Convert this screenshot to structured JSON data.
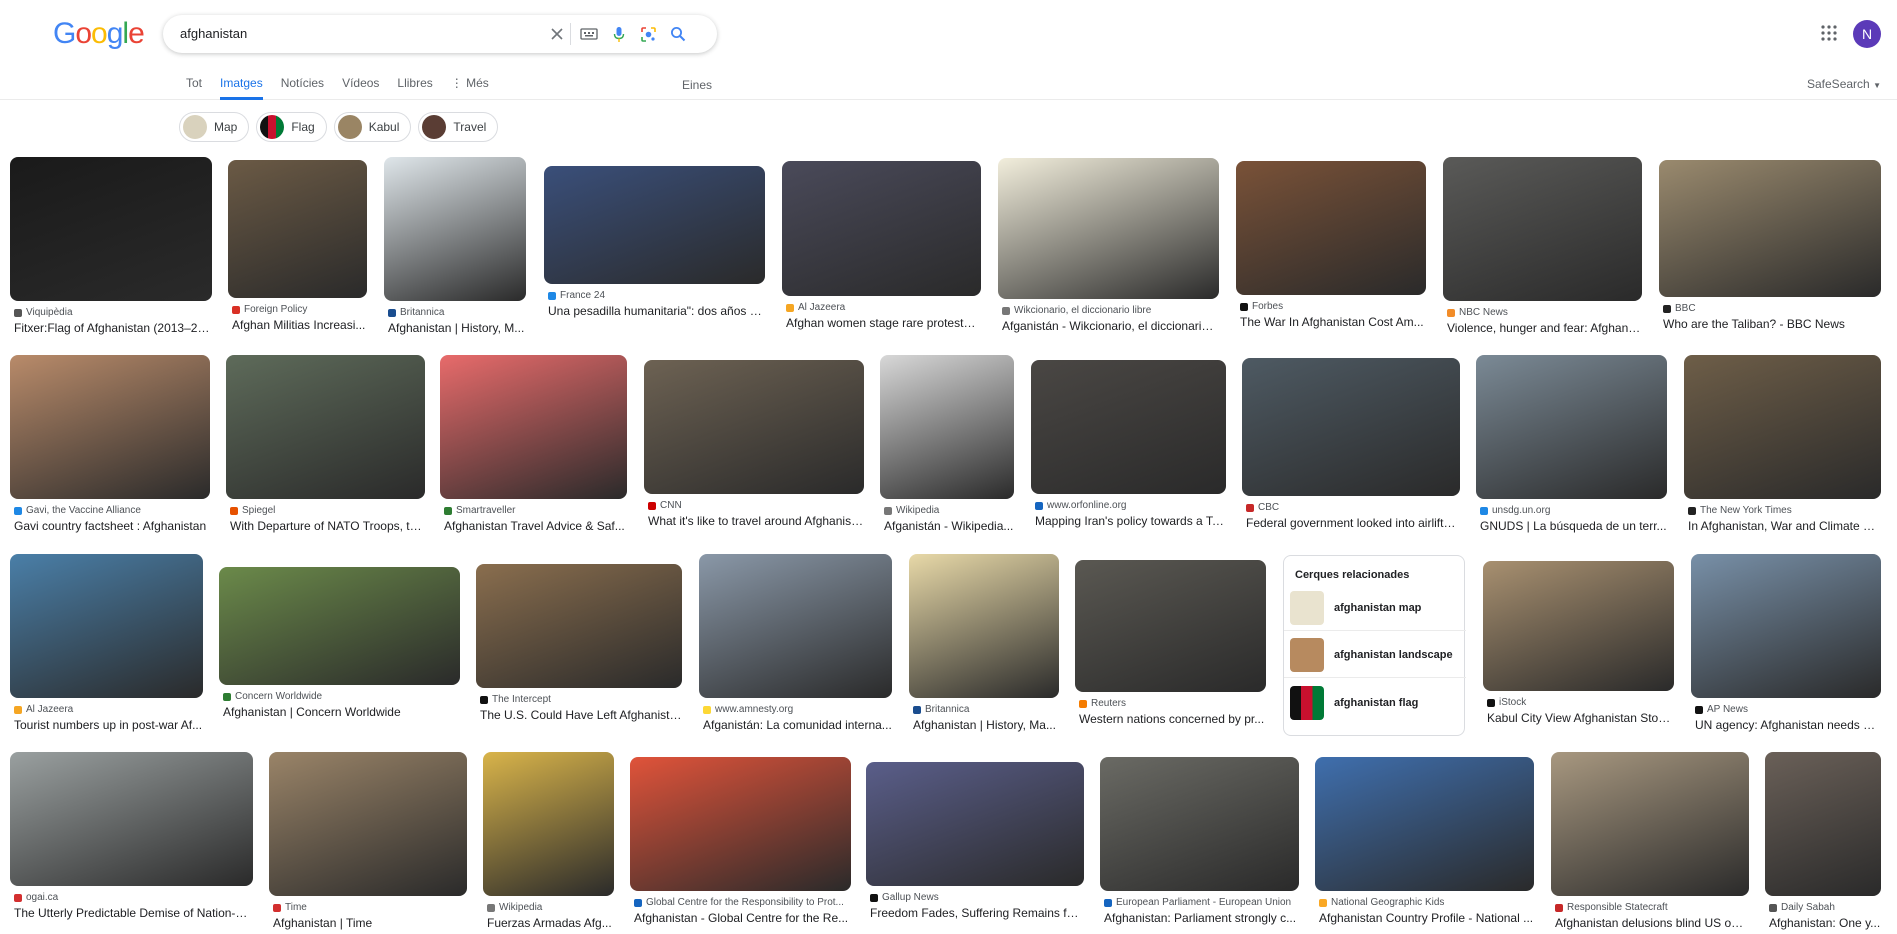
{
  "search": {
    "query": "afghanistan"
  },
  "header": {
    "logo_letters": [
      "G",
      "o",
      "o",
      "g",
      "l",
      "e"
    ],
    "avatar_letter": "N"
  },
  "tabs": [
    {
      "label": "Tot",
      "active": false
    },
    {
      "label": "Imatges",
      "active": true
    },
    {
      "label": "Notícies",
      "active": false
    },
    {
      "label": "Vídeos",
      "active": false
    },
    {
      "label": "Llibres",
      "active": false
    },
    {
      "label": "⋮ Més",
      "active": false
    }
  ],
  "tools_label": "Eines",
  "safesearch_label": "SafeSearch",
  "chips": [
    {
      "label": "Map",
      "color": "#d9d2bd"
    },
    {
      "label": "Flag",
      "color": "#c8102e"
    },
    {
      "label": "Kabul",
      "color": "#9a8564"
    },
    {
      "label": "Travel",
      "color": "#5a3d34"
    }
  ],
  "related": {
    "heading": "Cerques relacionades",
    "items": [
      {
        "label": "afghanistan map",
        "color": "#e9e3cf"
      },
      {
        "label": "afghanistan landscape",
        "color": "#b78a5f"
      },
      {
        "label": "afghanistan flag",
        "color": "#cf2a2a"
      }
    ]
  },
  "results": [
    {
      "source": "Viquipèdia",
      "title": "Fitxer:Flag of Afghanistan (2013–20...",
      "color": "#1a1a1a",
      "icon": "#555"
    },
    {
      "source": "Foreign Policy",
      "title": "Afghan Militias Increasi...",
      "color": "#6b5a45",
      "icon": "#d93025"
    },
    {
      "source": "Britannica",
      "title": "Afghanistan | History, M...",
      "color": "#dfe6ea",
      "icon": "#1a4d8f"
    },
    {
      "source": "France 24",
      "title": "Una pesadilla humanitaria\": dos años d...",
      "color": "#3a4f7a",
      "icon": "#1e88e5"
    },
    {
      "source": "Al Jazeera",
      "title": "Afghan women stage rare protests, ...",
      "color": "#4a4a5a",
      "icon": "#f5a623"
    },
    {
      "source": "Wikcionario, el diccionario libre",
      "title": "Afganistán - Wikcionario, el diccionario ...",
      "color": "#f2eedc",
      "icon": "#777"
    },
    {
      "source": "Forbes",
      "title": "The War In Afghanistan Cost Am...",
      "color": "#7a5238",
      "icon": "#111"
    },
    {
      "source": "NBC News",
      "title": "Violence, hunger and fear: Afghanis...",
      "color": "#5a5a58",
      "icon": "#f28c28"
    },
    {
      "source": "BBC",
      "title": "Who are the Taliban? - BBC News",
      "color": "#9a8a6e",
      "icon": "#222"
    },
    {
      "source": "Gavi, the Vaccine Alliance",
      "title": "Gavi country factsheet : Afghanistan",
      "color": "#b98b6a",
      "icon": "#1e88e5"
    },
    {
      "source": "Spiegel",
      "title": "With Departure of NATO Troops, th...",
      "color": "#5e6b5a",
      "icon": "#e65100"
    },
    {
      "source": "Smartraveller",
      "title": "Afghanistan Travel Advice & Saf...",
      "color": "#e86b6b",
      "icon": "#2e7d32"
    },
    {
      "source": "CNN",
      "title": "What it's like to travel around Afghanist...",
      "color": "#6d6253",
      "icon": "#cc0000"
    },
    {
      "source": "Wikipedia",
      "title": "Afganistán - Wikipedia...",
      "color": "#d8d8d8",
      "icon": "#777"
    },
    {
      "source": "www.orfonline.org",
      "title": "Mapping Iran's policy towards a Ta...",
      "color": "#4a4744",
      "icon": "#1565c0"
    },
    {
      "source": "CBC",
      "title": "Federal government looked into airlifts ...",
      "color": "#4e5a63",
      "icon": "#c62828"
    },
    {
      "source": "unsdg.un.org",
      "title": "GNUDS | La búsqueda de un terr...",
      "color": "#7b8a96",
      "icon": "#1e88e5"
    },
    {
      "source": "The New York Times",
      "title": "In Afghanistan, War and Climate C...",
      "color": "#6e5e48",
      "icon": "#222"
    },
    {
      "source": "Al Jazeera",
      "title": "Tourist numbers up in post-war Af...",
      "color": "#4a7fa8",
      "icon": "#f5a623"
    },
    {
      "source": "Concern Worldwide",
      "title": "Afghanistan | Concern Worldwide",
      "color": "#6b8a4a",
      "icon": "#2e7d32"
    },
    {
      "source": "The Intercept",
      "title": "The U.S. Could Have Left Afghanista...",
      "color": "#8a6e4e",
      "icon": "#111"
    },
    {
      "source": "www.amnesty.org",
      "title": "Afganistán: La comunidad interna...",
      "color": "#8a98a8",
      "icon": "#fdd835"
    },
    {
      "source": "Britannica",
      "title": "Afghanistan | History, Ma...",
      "color": "#e8d9a8",
      "icon": "#1a4d8f"
    },
    {
      "source": "Reuters",
      "title": "Western nations concerned by pr...",
      "color": "#5a5852",
      "icon": "#f57c00"
    },
    {
      "source": "iStock",
      "title": "Kabul City View Afghanistan Stoc...",
      "color": "#a89070",
      "icon": "#111"
    },
    {
      "source": "AP News",
      "title": "UN agency: Afghanistan needs S...",
      "color": "#7890a8",
      "icon": "#111"
    },
    {
      "source": "ogai.ca",
      "title": "The Utterly Predictable Demise of Nation-B...",
      "color": "#9aa0a0",
      "icon": "#d32f2f"
    },
    {
      "source": "Time",
      "title": "Afghanistan | Time",
      "color": "#9a8468",
      "icon": "#d32f2f"
    },
    {
      "source": "Wikipedia",
      "title": "Fuerzas Armadas Afg...",
      "color": "#d9b44a",
      "icon": "#777"
    },
    {
      "source": "Global Centre for the Responsibility to Prot...",
      "title": "Afghanistan - Global Centre for the Re...",
      "color": "#e0533a",
      "icon": "#1565c0"
    },
    {
      "source": "Gallup News",
      "title": "Freedom Fades, Suffering Remains for...",
      "color": "#5a5e8a",
      "icon": "#111"
    },
    {
      "source": "European Parliament - European Union",
      "title": "Afghanistan: Parliament strongly c...",
      "color": "#6a6a64",
      "icon": "#1565c0"
    },
    {
      "source": "National Geographic Kids",
      "title": "Afghanistan Country Profile - National ...",
      "color": "#3f6fae",
      "icon": "#f9a825"
    },
    {
      "source": "Responsible Statecraft",
      "title": "Afghanistan delusions blind US on ...",
      "color": "#a89880",
      "icon": "#c62828"
    },
    {
      "source": "Daily Sabah",
      "title": "Afghanistan: One y...",
      "color": "#6a6058",
      "icon": "#555"
    }
  ]
}
